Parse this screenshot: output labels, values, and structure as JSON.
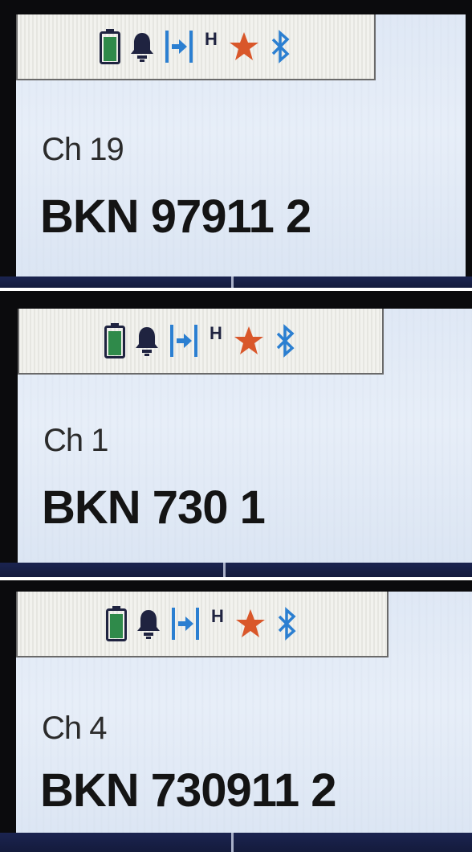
{
  "screens": [
    {
      "channel": "Ch 19",
      "callsign": "BKN 97911 2",
      "status_icons": [
        "battery-icon",
        "bell-icon",
        "skip-forward-icon",
        "h-icon",
        "star-icon",
        "bluetooth-icon"
      ]
    },
    {
      "channel": "Ch 1",
      "callsign": "BKN 730 1",
      "status_icons": [
        "battery-icon",
        "bell-icon",
        "skip-forward-icon",
        "h-icon",
        "star-icon",
        "bluetooth-icon"
      ]
    },
    {
      "channel": "Ch 4",
      "callsign": "BKN 730911 2",
      "status_icons": [
        "battery-icon",
        "bell-icon",
        "skip-forward-icon",
        "h-icon",
        "star-icon",
        "bluetooth-icon"
      ]
    }
  ],
  "status_text": {
    "h_label": "H"
  },
  "colors": {
    "battery": "#2f8a4a",
    "bell": "#1f2340",
    "skip": "#2b7fd1",
    "star": "#d9572a",
    "bluetooth": "#2b7fd1",
    "h": "#1f2340"
  }
}
